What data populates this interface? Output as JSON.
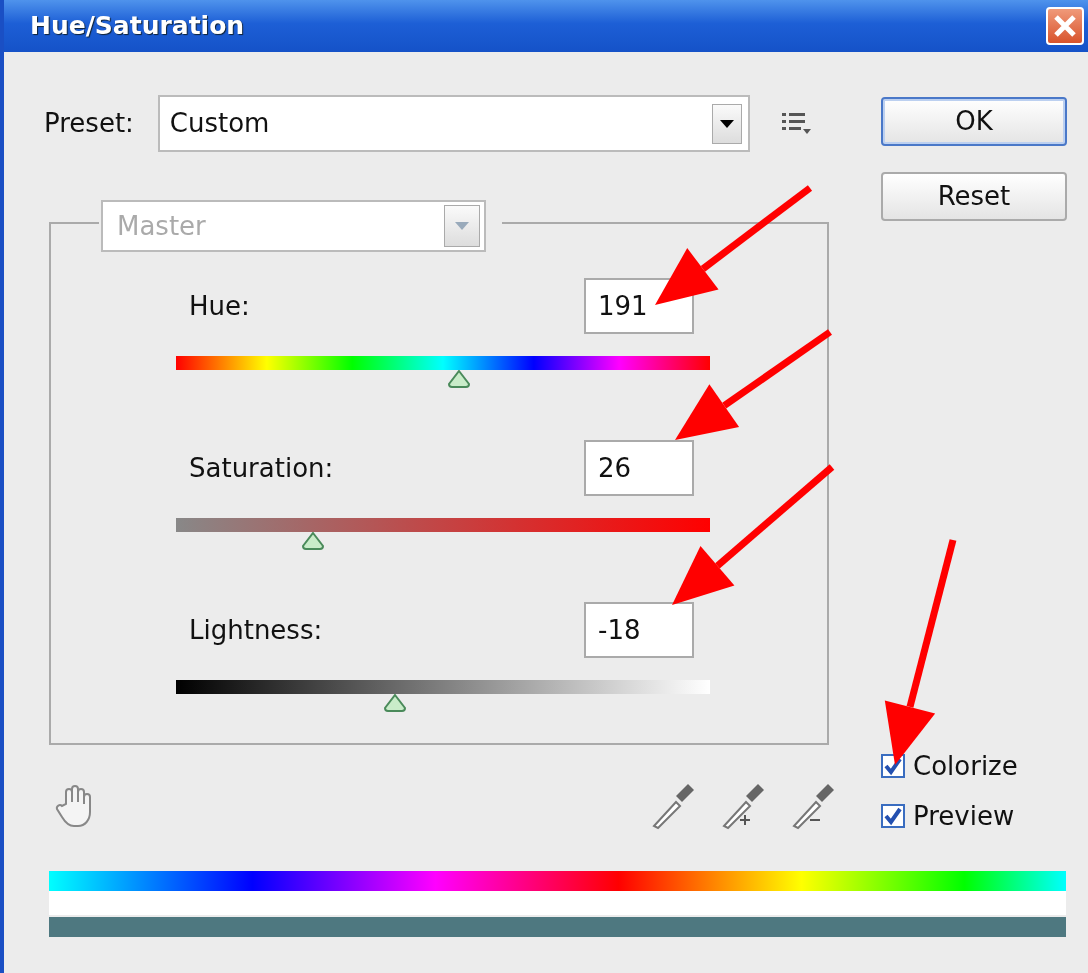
{
  "window": {
    "title": "Hue/Saturation"
  },
  "preset": {
    "label": "Preset:",
    "value": "Custom"
  },
  "channel": {
    "value": "Master",
    "disabled": true
  },
  "sliders": [
    {
      "kind": "hue",
      "label": "Hue:",
      "value": "191",
      "level": 0.53
    },
    {
      "kind": "saturation",
      "label": "Saturation:",
      "value": "26",
      "level": 0.257
    },
    {
      "kind": "lightness",
      "label": "Lightness:",
      "value": "-18",
      "level": 0.41
    }
  ],
  "buttons": [
    {
      "label": "OK",
      "default": true
    },
    {
      "label": "Reset",
      "default": false
    }
  ],
  "checkboxes": [
    {
      "label": "Colorize",
      "checked": true
    },
    {
      "label": "Preview",
      "checked": true
    }
  ],
  "annotations": [
    {
      "kind": "arrow"
    },
    {
      "kind": "arrow"
    },
    {
      "kind": "arrow"
    },
    {
      "kind": "arrow"
    }
  ]
}
